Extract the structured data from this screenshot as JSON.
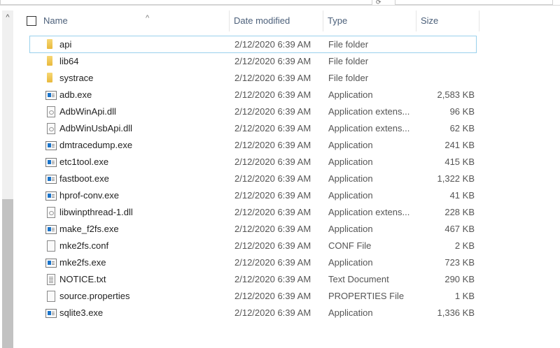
{
  "header": {
    "name": "Name",
    "date": "Date modified",
    "type": "Type",
    "size": "Size"
  },
  "files": [
    {
      "name": "api",
      "date": "2/12/2020 6:39 AM",
      "type": "File folder",
      "size": "",
      "icon": "folder"
    },
    {
      "name": "lib64",
      "date": "2/12/2020 6:39 AM",
      "type": "File folder",
      "size": "",
      "icon": "folder"
    },
    {
      "name": "systrace",
      "date": "2/12/2020 6:39 AM",
      "type": "File folder",
      "size": "",
      "icon": "folder"
    },
    {
      "name": "adb.exe",
      "date": "2/12/2020 6:39 AM",
      "type": "Application",
      "size": "2,583 KB",
      "icon": "app"
    },
    {
      "name": "AdbWinApi.dll",
      "date": "2/12/2020 6:39 AM",
      "type": "Application extens...",
      "size": "96 KB",
      "icon": "dll"
    },
    {
      "name": "AdbWinUsbApi.dll",
      "date": "2/12/2020 6:39 AM",
      "type": "Application extens...",
      "size": "62 KB",
      "icon": "dll"
    },
    {
      "name": "dmtracedump.exe",
      "date": "2/12/2020 6:39 AM",
      "type": "Application",
      "size": "241 KB",
      "icon": "app"
    },
    {
      "name": "etc1tool.exe",
      "date": "2/12/2020 6:39 AM",
      "type": "Application",
      "size": "415 KB",
      "icon": "app"
    },
    {
      "name": "fastboot.exe",
      "date": "2/12/2020 6:39 AM",
      "type": "Application",
      "size": "1,322 KB",
      "icon": "app"
    },
    {
      "name": "hprof-conv.exe",
      "date": "2/12/2020 6:39 AM",
      "type": "Application",
      "size": "41 KB",
      "icon": "app"
    },
    {
      "name": "libwinpthread-1.dll",
      "date": "2/12/2020 6:39 AM",
      "type": "Application extens...",
      "size": "228 KB",
      "icon": "dll"
    },
    {
      "name": "make_f2fs.exe",
      "date": "2/12/2020 6:39 AM",
      "type": "Application",
      "size": "467 KB",
      "icon": "app"
    },
    {
      "name": "mke2fs.conf",
      "date": "2/12/2020 6:39 AM",
      "type": "CONF File",
      "size": "2 KB",
      "icon": "file"
    },
    {
      "name": "mke2fs.exe",
      "date": "2/12/2020 6:39 AM",
      "type": "Application",
      "size": "723 KB",
      "icon": "app"
    },
    {
      "name": "NOTICE.txt",
      "date": "2/12/2020 6:39 AM",
      "type": "Text Document",
      "size": "290 KB",
      "icon": "txt"
    },
    {
      "name": "source.properties",
      "date": "2/12/2020 6:39 AM",
      "type": "PROPERTIES File",
      "size": "1 KB",
      "icon": "file"
    },
    {
      "name": "sqlite3.exe",
      "date": "2/12/2020 6:39 AM",
      "type": "Application",
      "size": "1,336 KB",
      "icon": "app"
    }
  ]
}
